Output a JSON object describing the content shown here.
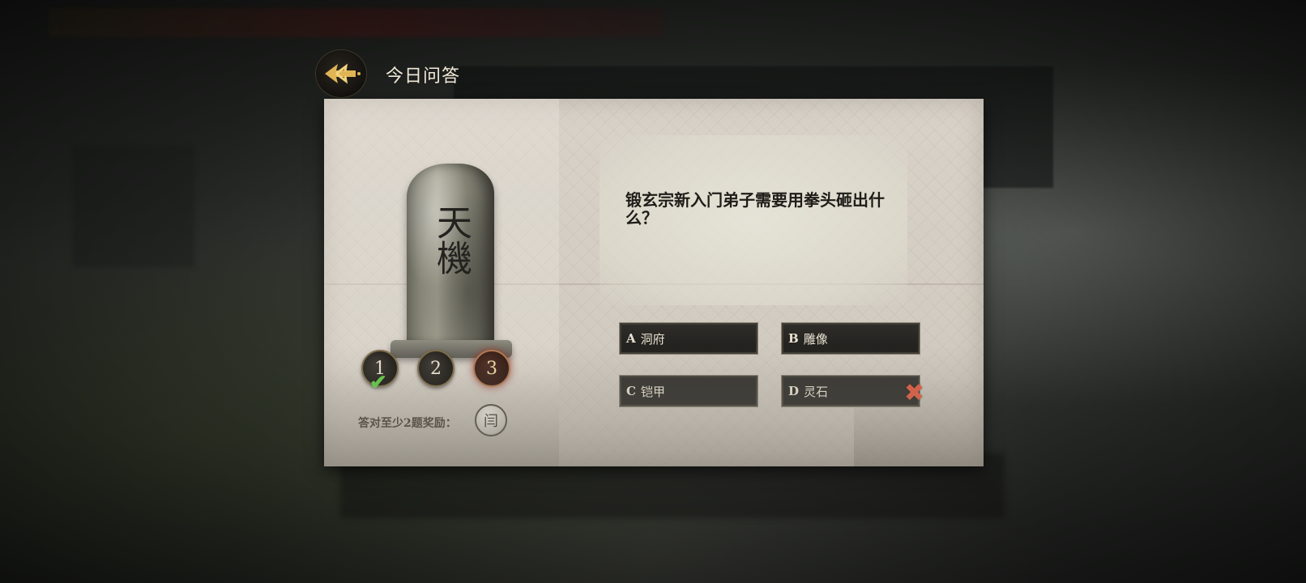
{
  "header": {
    "title": "今日问答",
    "back_icon": "back-arrow-icon"
  },
  "stele": {
    "inscription": "天機"
  },
  "progress": [
    {
      "number": "1",
      "state": "correct"
    },
    {
      "number": "2",
      "state": "pending"
    },
    {
      "number": "3",
      "state": "current"
    }
  ],
  "reward": {
    "label": "答对至少2题奖励：",
    "icon_glyph": "闫"
  },
  "question": {
    "text": "锻玄宗新入门弟子需要用拳头砸出什么？"
  },
  "options": [
    {
      "letter": "A",
      "text": "洞府",
      "state": "normal"
    },
    {
      "letter": "B",
      "text": "雕像",
      "state": "normal"
    },
    {
      "letter": "C",
      "text": "铠甲",
      "state": "normal"
    },
    {
      "letter": "D",
      "text": "灵石",
      "state": "wrong"
    }
  ],
  "colors": {
    "correct": "#5ecb44",
    "wrong": "#e0553a",
    "gold": "#e0b555"
  }
}
